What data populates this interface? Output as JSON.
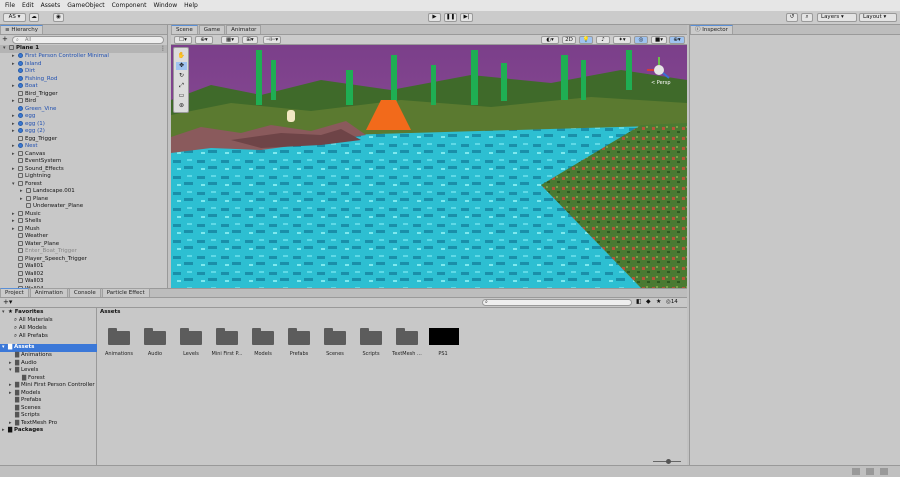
{
  "menu": [
    "File",
    "Edit",
    "Assets",
    "GameObject",
    "Component",
    "Window",
    "Help"
  ],
  "toolbar": {
    "account": "AS ▾",
    "layers": "Layers",
    "layout": "Layout"
  },
  "scene_tabs": [
    "Scene",
    "Game",
    "Animator"
  ],
  "scene_toolbar": {
    "mode_2d": "2D",
    "persp": "< Persp"
  },
  "hierarchy": {
    "title": "Hierarchy",
    "search_placeholder": "All",
    "root": "Plane 1",
    "items": [
      {
        "label": "First Person Controller Minimal",
        "indent": 1,
        "arrow": true,
        "blue": true,
        "icon": "blue"
      },
      {
        "label": "Island",
        "indent": 1,
        "arrow": true,
        "blue": true,
        "icon": "blue"
      },
      {
        "label": "Dirt",
        "indent": 1,
        "arrow": false,
        "blue": true,
        "icon": "blue"
      },
      {
        "label": "Fishing_Rod",
        "indent": 1,
        "arrow": false,
        "blue": true,
        "icon": "blue"
      },
      {
        "label": "Boat",
        "indent": 1,
        "arrow": true,
        "blue": true,
        "icon": "blue"
      },
      {
        "label": "Bird_Trigger",
        "indent": 1,
        "arrow": false,
        "blue": false,
        "icon": "cube"
      },
      {
        "label": "Bird",
        "indent": 1,
        "arrow": true,
        "blue": false,
        "icon": "cube"
      },
      {
        "label": "Green_Vine",
        "indent": 1,
        "arrow": false,
        "blue": true,
        "icon": "blue"
      },
      {
        "label": "egg",
        "indent": 1,
        "arrow": true,
        "blue": true,
        "icon": "blue"
      },
      {
        "label": "egg (1)",
        "indent": 1,
        "arrow": true,
        "blue": true,
        "icon": "blue"
      },
      {
        "label": "egg (2)",
        "indent": 1,
        "arrow": true,
        "blue": true,
        "icon": "blue"
      },
      {
        "label": "Egg_Trigger",
        "indent": 1,
        "arrow": false,
        "blue": false,
        "icon": "cube"
      },
      {
        "label": "Nest",
        "indent": 1,
        "arrow": true,
        "blue": true,
        "icon": "blue"
      },
      {
        "label": "Canvas",
        "indent": 1,
        "arrow": true,
        "blue": false,
        "icon": "cube"
      },
      {
        "label": "EventSystem",
        "indent": 1,
        "arrow": false,
        "blue": false,
        "icon": "cube"
      },
      {
        "label": "Sound_Effects",
        "indent": 1,
        "arrow": true,
        "blue": false,
        "icon": "cube"
      },
      {
        "label": "Lightning",
        "indent": 1,
        "arrow": false,
        "blue": false,
        "icon": "cube"
      },
      {
        "label": "Forest",
        "indent": 1,
        "arrow": true,
        "blue": false,
        "icon": "cube",
        "open": true
      },
      {
        "label": "Landscape.001",
        "indent": 2,
        "arrow": true,
        "blue": false,
        "icon": "cube"
      },
      {
        "label": "Plane",
        "indent": 2,
        "arrow": true,
        "blue": false,
        "icon": "cube"
      },
      {
        "label": "Underwater_Plane",
        "indent": 2,
        "arrow": false,
        "blue": false,
        "icon": "cube"
      },
      {
        "label": "Music",
        "indent": 1,
        "arrow": true,
        "blue": false,
        "icon": "cube"
      },
      {
        "label": "Shells",
        "indent": 1,
        "arrow": true,
        "blue": false,
        "icon": "cube"
      },
      {
        "label": "Mush",
        "indent": 1,
        "arrow": true,
        "blue": false,
        "icon": "cube"
      },
      {
        "label": "Weather",
        "indent": 1,
        "arrow": false,
        "blue": false,
        "icon": "cube"
      },
      {
        "label": "Water_Plane",
        "indent": 1,
        "arrow": false,
        "blue": false,
        "icon": "cube"
      },
      {
        "label": "Enter_Boat_Trigger",
        "indent": 1,
        "arrow": false,
        "blue": false,
        "icon": "cube",
        "grey": true
      },
      {
        "label": "Player_Speech_Trigger",
        "indent": 1,
        "arrow": false,
        "blue": false,
        "icon": "cube"
      },
      {
        "label": "Wall01",
        "indent": 1,
        "arrow": false,
        "blue": false,
        "icon": "cube"
      },
      {
        "label": "Wall02",
        "indent": 1,
        "arrow": false,
        "blue": false,
        "icon": "cube"
      },
      {
        "label": "Wall03",
        "indent": 1,
        "arrow": false,
        "blue": false,
        "icon": "cube"
      },
      {
        "label": "Wall04",
        "indent": 1,
        "arrow": false,
        "blue": false,
        "icon": "cube"
      }
    ]
  },
  "inspector": {
    "title": "Inspector"
  },
  "bottom_tabs": [
    "Project",
    "Animation",
    "Console",
    "Particle Effect"
  ],
  "project": {
    "count": "14",
    "favorites_title": "Favorites",
    "favorites": [
      "All Materials",
      "All Models",
      "All Prefabs"
    ],
    "assets_title": "Assets",
    "tree": [
      {
        "label": "Animations",
        "indent": 1,
        "arrow": false
      },
      {
        "label": "Audio",
        "indent": 1,
        "arrow": true
      },
      {
        "label": "Levels",
        "indent": 1,
        "arrow": true,
        "open": true
      },
      {
        "label": "Forest",
        "indent": 2,
        "arrow": false
      },
      {
        "label": "Mini First Person Controller",
        "indent": 1,
        "arrow": true
      },
      {
        "label": "Models",
        "indent": 1,
        "arrow": true
      },
      {
        "label": "Prefabs",
        "indent": 1,
        "arrow": false
      },
      {
        "label": "Scenes",
        "indent": 1,
        "arrow": false
      },
      {
        "label": "Scripts",
        "indent": 1,
        "arrow": false
      },
      {
        "label": "TextMesh Pro",
        "indent": 1,
        "arrow": true
      }
    ],
    "packages_title": "Packages",
    "grid_title": "Assets",
    "grid": [
      "Animations",
      "Audio",
      "Levels",
      "Mini First P...",
      "Models",
      "Prefabs",
      "Scenes",
      "Scripts",
      "TextMesh ...",
      "PS1"
    ]
  },
  "colors": {
    "selection": "#3b78d8",
    "water": "#2fc0d4",
    "link": "#1f4fb0"
  }
}
